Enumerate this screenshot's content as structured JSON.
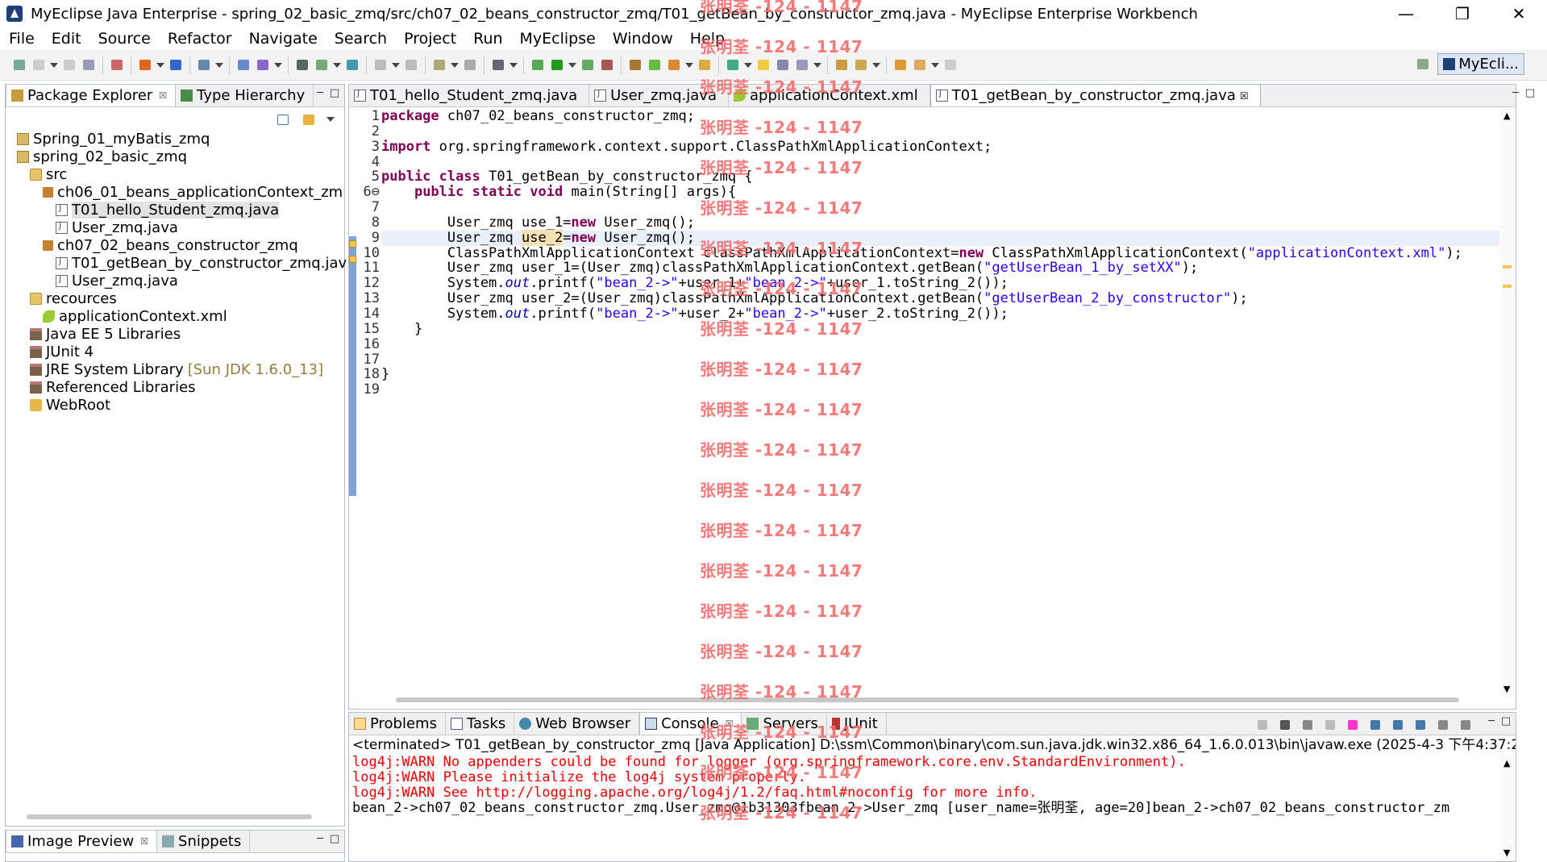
{
  "window": {
    "title": "MyEclipse Java Enterprise - spring_02_basic_zmq/src/ch07_02_beans_constructor_zmq/T01_getBean_by_constructor_zmq.java - MyEclipse Enterprise Workbench",
    "min": "—",
    "max": "❐",
    "close": "✕"
  },
  "menu": [
    "File",
    "Edit",
    "Source",
    "Refactor",
    "Navigate",
    "Search",
    "Project",
    "Run",
    "MyEclipse",
    "Window",
    "Help"
  ],
  "perspective": {
    "label": "MyEcli..."
  },
  "package_explorer": {
    "tabs": [
      {
        "label": "Package Explorer",
        "active": true,
        "icon": "package-explorer-icon"
      },
      {
        "label": "Type Hierarchy",
        "active": false,
        "icon": "type-hierarchy-icon"
      }
    ],
    "tree": [
      {
        "label": "Spring_01_myBatis_zmq",
        "depth": 0,
        "icon": "proj"
      },
      {
        "label": "spring_02_basic_zmq",
        "depth": 0,
        "icon": "proj"
      },
      {
        "label": "src",
        "depth": 1,
        "icon": "srcf"
      },
      {
        "label": "ch06_01_beans_applicationContext_zm",
        "depth": 2,
        "icon": "pkg"
      },
      {
        "label": "T01_hello_Student_zmq.java",
        "depth": 3,
        "icon": "java",
        "selected": true
      },
      {
        "label": "User_zmq.java",
        "depth": 3,
        "icon": "java"
      },
      {
        "label": "ch07_02_beans_constructor_zmq",
        "depth": 2,
        "icon": "pkg"
      },
      {
        "label": "T01_getBean_by_constructor_zmq.jav",
        "depth": 3,
        "icon": "java"
      },
      {
        "label": "User_zmq.java",
        "depth": 3,
        "icon": "java"
      },
      {
        "label": "recources",
        "depth": 1,
        "icon": "srcf"
      },
      {
        "label": "applicationContext.xml",
        "depth": 2,
        "icon": "xml"
      },
      {
        "label": "Java EE 5 Libraries",
        "depth": 1,
        "icon": "lib"
      },
      {
        "label": "JUnit 4",
        "depth": 1,
        "icon": "lib"
      },
      {
        "label": "JRE System Library",
        "deco": "[Sun JDK 1.6.0_13]",
        "depth": 1,
        "icon": "lib"
      },
      {
        "label": "Referenced Libraries",
        "depth": 1,
        "icon": "lib"
      },
      {
        "label": "WebRoot",
        "depth": 1,
        "icon": "folder"
      }
    ]
  },
  "image_preview": {
    "tabs": [
      {
        "label": "Image Preview",
        "active": true,
        "icon": "image-preview-icon"
      },
      {
        "label": "Snippets",
        "active": false,
        "icon": "snippets-icon"
      }
    ]
  },
  "editor": {
    "tabs": [
      {
        "label": "T01_hello_Student_zmq.java",
        "icon": "java"
      },
      {
        "label": "User_zmq.java",
        "icon": "java"
      },
      {
        "label": "applicationContext.xml",
        "icon": "xml"
      },
      {
        "label": "T01_getBean_by_constructor_zmq.java",
        "icon": "java",
        "active": true
      }
    ],
    "line_numbers": [
      "1",
      "2",
      "3",
      "4",
      "5",
      "6⊖",
      "7",
      "8",
      "9",
      "10",
      "11",
      "12",
      "13",
      "14",
      "15",
      "16",
      "17",
      "18",
      "19"
    ],
    "lines": [
      [
        {
          "k": "kw",
          "t": "package"
        },
        {
          "t": " ch07_02_beans_constructor_zmq;"
        }
      ],
      [],
      [
        {
          "k": "kw",
          "t": "import"
        },
        {
          "t": " org.springframework.context.support.ClassPathXmlApplicationContext;"
        }
      ],
      [],
      [
        {
          "k": "kw",
          "t": "public"
        },
        {
          "t": " "
        },
        {
          "k": "kw",
          "t": "class"
        },
        {
          "t": " T01_getBean_by_constructor_zmq {"
        }
      ],
      [
        {
          "t": "    "
        },
        {
          "k": "kw",
          "t": "public"
        },
        {
          "t": " "
        },
        {
          "k": "kw",
          "t": "static"
        },
        {
          "t": " "
        },
        {
          "k": "kw",
          "t": "void"
        },
        {
          "t": " main(String[] args){"
        }
      ],
      [],
      [
        {
          "t": "        User_zmq use_1="
        },
        {
          "k": "kw",
          "t": "new"
        },
        {
          "t": " User_zmq();"
        }
      ],
      [
        {
          "t": "        User_zmq "
        },
        {
          "k": "occ",
          "t": "use_2"
        },
        {
          "t": "="
        },
        {
          "k": "kw",
          "t": "new"
        },
        {
          "t": " User_zmq();"
        }
      ],
      [
        {
          "t": "        ClassPathXmlApplicationContext classPathXmlApplicationContext="
        },
        {
          "k": "kw",
          "t": "new"
        },
        {
          "t": " ClassPathXmlApplicationContext("
        },
        {
          "k": "str",
          "t": "\"applicationContext.xml\""
        },
        {
          "t": ");"
        }
      ],
      [
        {
          "t": "        User_zmq user_1=(User_zmq)classPathXmlApplicationContext.getBean("
        },
        {
          "k": "str",
          "t": "\"getUserBean_1_by_setXX\""
        },
        {
          "t": ");"
        }
      ],
      [
        {
          "t": "        System."
        },
        {
          "k": "fld",
          "t": "out"
        },
        {
          "t": ".printf("
        },
        {
          "k": "str",
          "t": "\"bean_2->\""
        },
        {
          "t": "+user_1+"
        },
        {
          "k": "str",
          "t": "\"bean_2->\""
        },
        {
          "t": "+user_1.toString_2());"
        }
      ],
      [
        {
          "t": "        User_zmq user_2=(User_zmq)classPathXmlApplicationContext.getBean("
        },
        {
          "k": "str",
          "t": "\"getUserBean_2_by_constructor\""
        },
        {
          "t": ");"
        }
      ],
      [
        {
          "t": "        System."
        },
        {
          "k": "fld",
          "t": "out"
        },
        {
          "t": ".printf("
        },
        {
          "k": "str",
          "t": "\"bean_2->\""
        },
        {
          "t": "+user_2+"
        },
        {
          "k": "str",
          "t": "\"bean_2->\""
        },
        {
          "t": "+user_2.toString_2());"
        }
      ],
      [
        {
          "t": "    }"
        }
      ],
      [],
      [],
      [
        {
          "t": "}"
        }
      ],
      []
    ]
  },
  "console": {
    "tabs": [
      {
        "label": "Problems",
        "icon": "prob"
      },
      {
        "label": "Tasks",
        "icon": "task"
      },
      {
        "label": "Web Browser",
        "icon": "web"
      },
      {
        "label": "Console",
        "icon": "con",
        "active": true
      },
      {
        "label": "Servers",
        "icon": "srv"
      },
      {
        "label": "JUnit",
        "icon": "ju"
      }
    ],
    "header": "<terminated> T01_getBean_by_constructor_zmq [Java Application] D:\\ssm\\Common\\binary\\com.sun.java.jdk.win32.x86_64_1.6.0.013\\bin\\javaw.exe (2025-4-3 下午4:37:27)",
    "lines": [
      {
        "text": "log4j:WARN No appenders could be found for logger (org.springframework.core.env.StandardEnvironment).",
        "err": true
      },
      {
        "text": "log4j:WARN Please initialize the log4j system properly.",
        "err": true
      },
      {
        "text": "log4j:WARN See http://logging.apache.org/log4j/1.2/faq.html#noconfig for more info.",
        "err": true
      },
      {
        "text": "bean_2->ch07_02_beans_constructor_zmq.User_zmq@1b31303fbean_2->User_zmq [user_name=张明荃, age=20]bean_2->ch07_02_beans_constructor_zm",
        "err": false
      }
    ]
  },
  "watermark": {
    "text": "张明荃 -124 - 1147",
    "count": 21
  },
  "colors": {
    "keyword": "#7f0055",
    "string": "#2a00ff",
    "field": "#0000c0",
    "error": "#e00000",
    "watermark": "#f46c6c"
  }
}
